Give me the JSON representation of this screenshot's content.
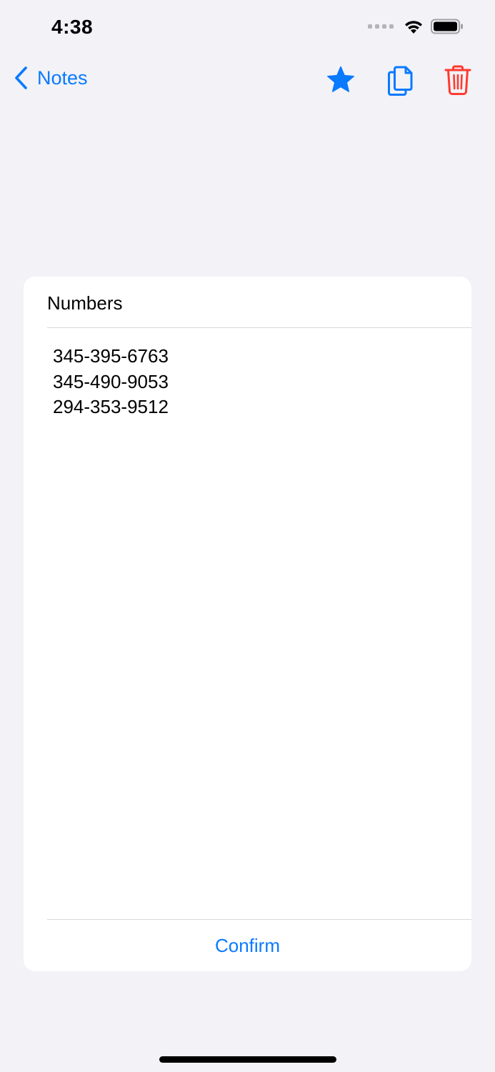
{
  "status_bar": {
    "time": "4:38"
  },
  "nav": {
    "back_label": "Notes",
    "actions": [
      {
        "icon": "star-icon",
        "color": "#0a7aff"
      },
      {
        "icon": "copy-icon",
        "color": "#0a7aff"
      },
      {
        "icon": "trash-icon",
        "color": "#ff3b30"
      }
    ]
  },
  "note": {
    "title": "Numbers",
    "lines": [
      "345-395-6763",
      "345-490-9053",
      "294-353-9512"
    ],
    "confirm_label": "Confirm"
  },
  "colors": {
    "accent": "#0a7aff",
    "destructive": "#ff3b30",
    "background": "#f2f2f7",
    "card": "#ffffff"
  }
}
